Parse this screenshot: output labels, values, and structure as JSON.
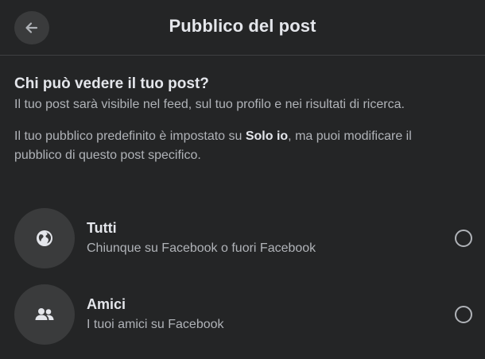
{
  "header": {
    "title": "Pubblico del post",
    "back_icon": "arrow-left-icon"
  },
  "intro": {
    "question": "Chi può vedere il tuo post?",
    "description": "Il tuo post sarà visibile nel feed, sul tuo profilo e nei risultati di ricerca.",
    "default_prefix": "Il tuo pubblico predefinito è impostato su ",
    "default_value": "Solo io",
    "default_suffix": ", ma puoi modificare il pubblico di questo post specifico."
  },
  "options": [
    {
      "title": "Tutti",
      "subtitle": "Chiunque su Facebook o fuori Facebook",
      "icon": "globe-icon",
      "selected": false
    },
    {
      "title": "Amici",
      "subtitle": "I tuoi amici su Facebook",
      "icon": "friends-icon",
      "selected": false
    }
  ],
  "colors": {
    "background": "#242526",
    "icon_circle": "#3a3b3c",
    "primary_text": "#e4e6eb",
    "secondary_text": "#b0b3b8"
  }
}
